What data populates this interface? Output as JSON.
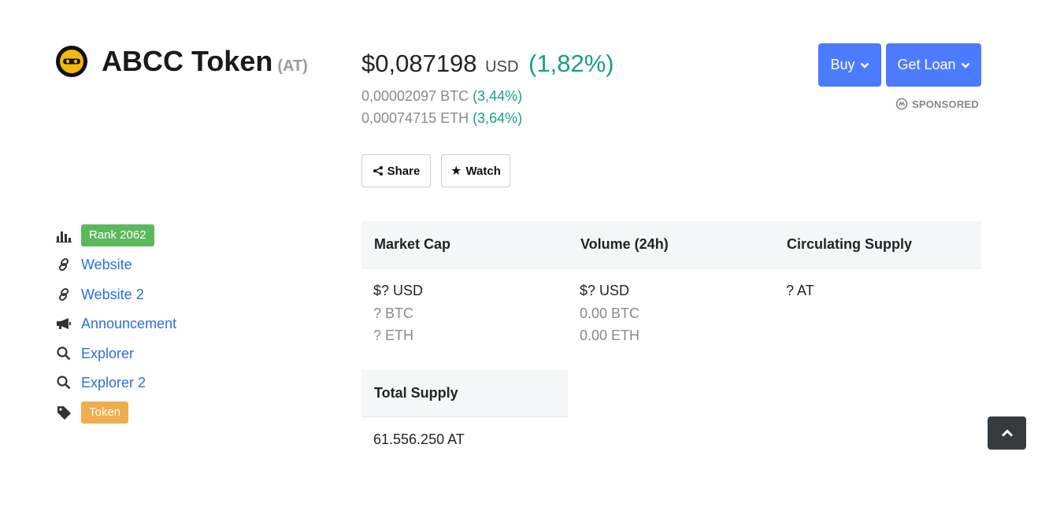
{
  "coin": {
    "name": "ABCC Token",
    "symbol": "(AT)"
  },
  "price": {
    "usd": "$0,087198",
    "usd_unit": "USD",
    "usd_change": "(1,82%)",
    "btc": "0,00002097 BTC",
    "btc_change": "(3,44%)",
    "eth": "0,00074715 ETH",
    "eth_change": "(3,64%)"
  },
  "actions": {
    "share": "Share",
    "watch": "Watch",
    "buy": "Buy",
    "loan": "Get Loan",
    "sponsored": "SPONSORED"
  },
  "sidebar": {
    "rank": "Rank 2062",
    "links": [
      "Website",
      "Website 2",
      "Announcement",
      "Explorer",
      "Explorer 2"
    ],
    "tag": "Token"
  },
  "stats": {
    "headers": [
      "Market Cap",
      "Volume (24h)",
      "Circulating Supply"
    ],
    "market_cap": [
      "$? USD",
      "? BTC",
      "? ETH"
    ],
    "volume": [
      "$? USD",
      "0.00 BTC",
      "0.00 ETH"
    ],
    "circulating": [
      "? AT"
    ],
    "total_header": "Total Supply",
    "total": "61.556.250 AT"
  },
  "colors": {
    "accent": "#4d7bff",
    "positive": "#16a085",
    "link": "#2a6fdb",
    "rank": "#5cb85c",
    "tag": "#f0ad4e"
  }
}
